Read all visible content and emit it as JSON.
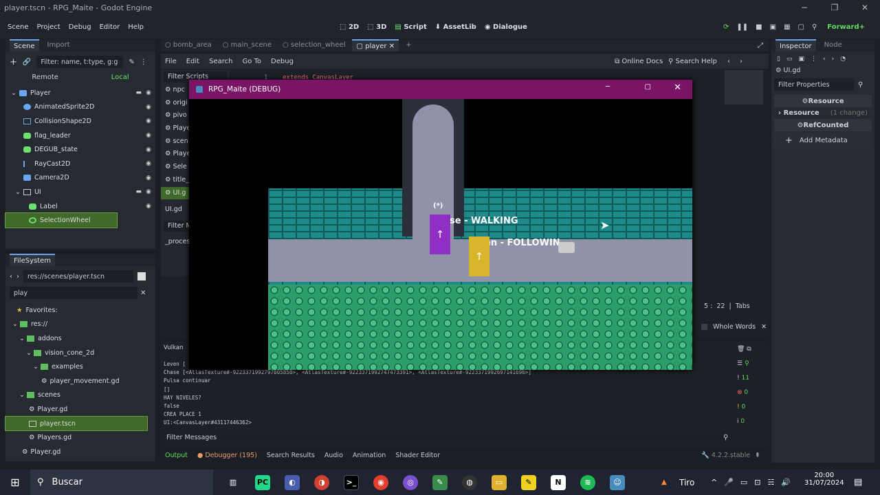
{
  "window": {
    "title": "player.tscn - RPG_Maite - Godot Engine"
  },
  "menu": {
    "items": [
      "Scene",
      "Project",
      "Debug",
      "Editor",
      "Help"
    ]
  },
  "modes": {
    "m2d": "2D",
    "m3d": "3D",
    "script": "Script",
    "assetlib": "AssetLib",
    "dialogue": "Dialogue"
  },
  "renderer": "Forward+",
  "scene_dock": {
    "tabs": [
      "Scene",
      "Import"
    ],
    "filter_placeholder": "Filter: name, t:type, g:g",
    "remote": "Remote",
    "local": "Local",
    "nodes": [
      "Player",
      "AnimatedSprite2D",
      "CollisionShape2D",
      "flag_leader",
      "DEGUB_state",
      "RayCast2D",
      "Camera2D",
      "UI",
      "Label",
      "SelectionWheel"
    ]
  },
  "filesystem": {
    "title": "FileSystem",
    "path": "res://scenes/player.tscn",
    "search": "play",
    "items": [
      "Favorites:",
      "res://",
      "addons",
      "vision_cone_2d",
      "examples",
      "player_movement.gd",
      "scenes",
      "Player.gd",
      "player.tscn",
      "Players.gd",
      "Player.gd"
    ]
  },
  "editor_tabs": [
    "bomb_area",
    "main_scene",
    "selection_wheel",
    "player"
  ],
  "script_menu": [
    "File",
    "Edit",
    "Search",
    "Go To",
    "Debug"
  ],
  "script_help": {
    "online_docs": "Online Docs",
    "search_help": "Search Help"
  },
  "script_list": {
    "filter": "Filter Scripts",
    "items": [
      "npc",
      "origi",
      "pivo",
      "Playe",
      "scen",
      "Playe",
      "Sele",
      "title_",
      "UI.g"
    ],
    "current": "UI.gd",
    "filter_methods": "Filter M",
    "method": "_proces"
  },
  "code_line": {
    "number": "1",
    "text": "extends CanvasLayer"
  },
  "cursor": {
    "line": "5",
    "col": "22",
    "indent": "Tabs"
  },
  "find": {
    "whole_words": "Whole Words"
  },
  "output": {
    "vulkan": "Vulkan",
    "lines": [
      "Leven [",
      "Chase [<AtlasTexture#-9223371992797805858>, <AtlasTexture#-9223371992747473391>, <AtlasTexture#-9223371992697141696>]",
      "Pulsa continuar",
      "[]",
      "HAY NIVELES?",
      "false",
      "CREA PLACE 1",
      "UI:<CanvasLayer#43117446362>"
    ],
    "filter": "Filter Messages",
    "counts": [
      "11",
      "0",
      "0",
      "0"
    ]
  },
  "bottom_tabs": [
    "Output",
    "Debugger (195)",
    "Search Results",
    "Audio",
    "Animation",
    "Shader Editor"
  ],
  "version": "4.2.2.stable",
  "inspector": {
    "tabs": [
      "Inspector",
      "Node"
    ],
    "file": "UI.gd",
    "filter": "Filter Properties",
    "resource_header": "Resource",
    "resource": "Resource",
    "change": "(1 change)",
    "refcounted": "RefCounted",
    "add_metadata": "Add Metadata"
  },
  "game": {
    "title": "RPG_Maite (DEBUG)",
    "marker": "(*)",
    "label1": "se - WALKING",
    "label2": "en - FOLLOWIN",
    "arrow": "↑"
  },
  "taskbar": {
    "search": "Buscar",
    "weather": "Tiro",
    "time": "20:00",
    "date": "31/07/2024"
  },
  "colors": {
    "accent": "#6ba7f0",
    "green": "#5fdc5f",
    "game_bar": "#7a1565",
    "brick": "#2a8c8c",
    "grass": "#2c9e6c",
    "player1": "#8f2fc4",
    "player2": "#d8b52a"
  }
}
